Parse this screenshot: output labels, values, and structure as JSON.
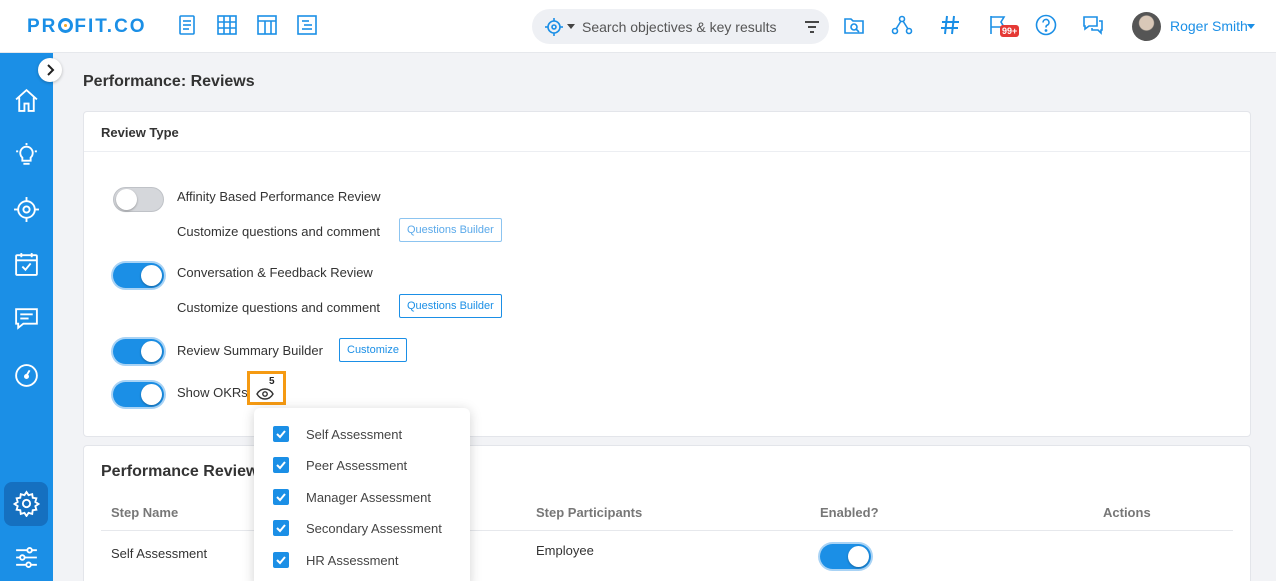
{
  "brand": {
    "logo_pre": "PR",
    "logo_post": "FIT.CO"
  },
  "colors": {
    "accent": "#1b8fe6",
    "highlight": "#f59a12",
    "badge": "#e53935"
  },
  "header": {
    "nav_icons": [
      "document-icon",
      "grid-icon",
      "columns-icon",
      "list-document-icon"
    ],
    "search": {
      "placeholder": "Search objectives & key results"
    },
    "right_icons": [
      "folder-search-icon",
      "org-chart-icon",
      "hashtag-icon",
      "flag-icon",
      "help-icon",
      "chat-icon"
    ],
    "notification_badge": "99+",
    "user": {
      "name": "Roger Smith"
    }
  },
  "sidebar": {
    "icons": [
      "home-icon",
      "lightbulb-icon",
      "target-icon",
      "calendar-check-icon",
      "feedback-icon",
      "gauge-icon",
      "settings-icon",
      "sliders-icon"
    ],
    "active": "settings-icon"
  },
  "page": {
    "title": "Performance: Reviews"
  },
  "review_type": {
    "title": "Review Type",
    "items": [
      {
        "label": "Affinity Based Performance Review",
        "enabled": false,
        "sub_label": "Customize questions and comment",
        "button": "Questions Builder"
      },
      {
        "label": "Conversation & Feedback Review",
        "enabled": true,
        "sub_label": "Customize questions and comment",
        "button": "Questions Builder"
      },
      {
        "label": "Review Summary Builder",
        "enabled": true,
        "button": "Customize"
      },
      {
        "label": "Show OKRs",
        "enabled": true,
        "visible_count": "5"
      }
    ]
  },
  "okr_visibility": {
    "options": [
      {
        "label": "Self Assessment",
        "checked": true
      },
      {
        "label": "Peer Assessment",
        "checked": true
      },
      {
        "label": "Manager Assessment",
        "checked": true
      },
      {
        "label": "Secondary Assessment",
        "checked": true
      },
      {
        "label": "HR Assessment",
        "checked": true
      }
    ]
  },
  "performance_review": {
    "title": "Performance Review",
    "columns": [
      "Step Name",
      "Step Participants",
      "Enabled?",
      "Actions"
    ],
    "rows": [
      {
        "step_name": "Self Assessment",
        "participants": "Employee",
        "enabled": true
      }
    ]
  }
}
